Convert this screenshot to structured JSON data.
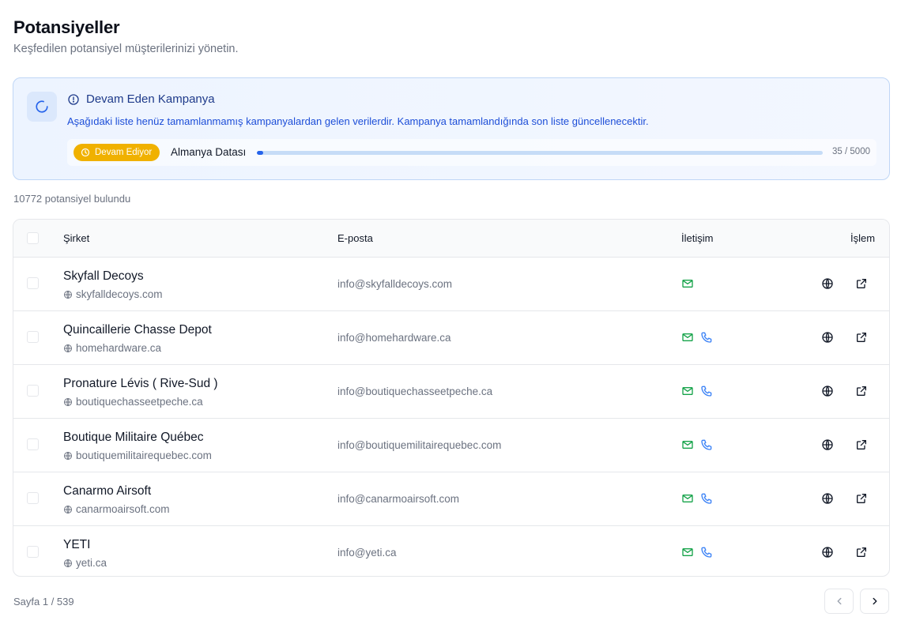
{
  "page": {
    "title": "Potansiyeller",
    "subtitle": "Keşfedilen potansiyel müşterilerinizi yönetin."
  },
  "campaign_banner": {
    "title": "Devam Eden Kampanya",
    "description": "Aşağıdaki liste henüz tamamlanmamış kampanyalardan gelen verilerdir. Kampanya tamamlandığında son liste güncellenecektir.",
    "status_label": "Devam Ediyor",
    "campaign_name": "Almanya Datası",
    "progress_current": 35,
    "progress_total": 5000,
    "progress_text": "35 / 5000",
    "accent_color": "#2563eb",
    "status_color": "#f0b100"
  },
  "results": {
    "count_text": "10772 potansiyel bulundu"
  },
  "table": {
    "columns": {
      "company": "Şirket",
      "email": "E-posta",
      "contact": "İletişim",
      "actions": "İşlem"
    },
    "rows": [
      {
        "company": "Skyfall Decoys",
        "domain": "skyfalldecoys.com",
        "email": "info@skyfalldecoys.com",
        "has_email": true,
        "has_phone": false
      },
      {
        "company": "Quincaillerie Chasse Depot",
        "domain": "homehardware.ca",
        "email": "info@homehardware.ca",
        "has_email": true,
        "has_phone": true
      },
      {
        "company": "Pronature Lévis ( Rive-Sud )",
        "domain": "boutiquechasseetpeche.ca",
        "email": "info@boutiquechasseetpeche.ca",
        "has_email": true,
        "has_phone": true
      },
      {
        "company": "Boutique Militaire Québec",
        "domain": "boutiquemilitairequebec.com",
        "email": "info@boutiquemilitairequebec.com",
        "has_email": true,
        "has_phone": true
      },
      {
        "company": "Canarmo Airsoft",
        "domain": "canarmoairsoft.com",
        "email": "info@canarmoairsoft.com",
        "has_email": true,
        "has_phone": true
      },
      {
        "company": "YETI",
        "domain": "yeti.ca",
        "email": "info@yeti.ca",
        "has_email": true,
        "has_phone": true
      }
    ]
  },
  "pagination": {
    "label": "Sayfa 1 / 539"
  },
  "icons": {
    "spinner": "loader-icon",
    "info": "info-circle-icon",
    "clock": "clock-icon",
    "globe": "globe-icon",
    "mail": "mail-icon",
    "phone": "phone-icon",
    "external": "external-link-icon",
    "prev": "chevron-left-icon",
    "next": "chevron-right-icon"
  },
  "colors": {
    "mail": "#16a34a",
    "phone": "#3b82f6"
  }
}
